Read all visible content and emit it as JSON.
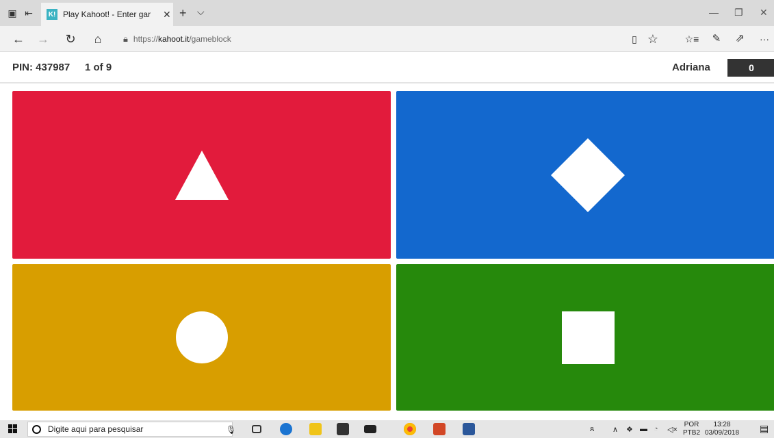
{
  "tab": {
    "favicon": "K!",
    "title": "Play Kahoot! - Enter gar",
    "close": "✕"
  },
  "tabstrip": {
    "new_tab": "+",
    "tab_menu": "⌵",
    "minimize": "—",
    "restore": "❐",
    "close": "✕"
  },
  "navbar": {
    "back": "←",
    "forward": "→",
    "refresh": "↻",
    "home": "⌂",
    "url_prefix": "https://",
    "url_domain": "kahoot.it",
    "url_path": "/gameblock",
    "reading_view": "▯",
    "favorite": "☆",
    "favorites_hub": "☆≡",
    "notes": "✎",
    "share": "⇗",
    "more": "···"
  },
  "game": {
    "pin": "PIN: 437987",
    "question_count": "1 of 9",
    "player_name": "Adriana",
    "score": "0"
  },
  "answers": [
    {
      "shape": "triangle",
      "color": "#e21b3c"
    },
    {
      "shape": "diamond",
      "color": "#1368ce"
    },
    {
      "shape": "circle",
      "color": "#d89e00"
    },
    {
      "shape": "square",
      "color": "#26890c"
    }
  ],
  "taskbar": {
    "search_placeholder": "Digite aqui para pesquisar",
    "lang_top": "POR",
    "lang_bottom": "PTB2",
    "time": "13:28",
    "date": "03/09/2018"
  }
}
